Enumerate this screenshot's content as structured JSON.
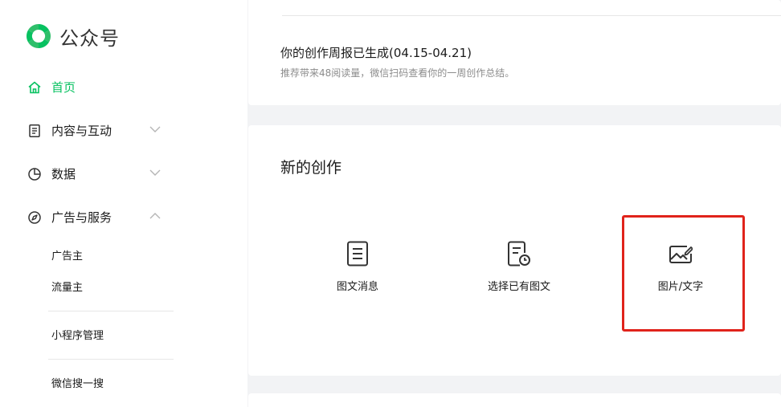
{
  "app": {
    "title": "公众号"
  },
  "sidebar": {
    "items": [
      {
        "label": "首页",
        "icon": "home-icon",
        "active": true
      },
      {
        "label": "内容与互动",
        "icon": "document-icon",
        "expanded": false
      },
      {
        "label": "数据",
        "icon": "pie-chart-icon",
        "expanded": false
      },
      {
        "label": "广告与服务",
        "icon": "compass-icon",
        "expanded": true
      }
    ],
    "sub_items": [
      {
        "label": "广告主"
      },
      {
        "label": "流量主"
      },
      {
        "label": "小程序管理"
      },
      {
        "label": "微信搜一搜"
      }
    ]
  },
  "report": {
    "title": "你的创作周报已生成(04.15-04.21)",
    "subtitle": "推荐带来48阅读量，微信扫码查看你的一周创作总结。"
  },
  "create": {
    "title": "新的创作",
    "options": [
      {
        "label": "图文消息",
        "icon": "article-icon"
      },
      {
        "label": "选择已有图文",
        "icon": "existing-article-icon"
      },
      {
        "label": "图片/文字",
        "icon": "image-text-icon",
        "highlighted": true
      }
    ]
  },
  "colors": {
    "brand_green": "#07c160",
    "highlight_red": "#e0231b",
    "background": "#f2f3f5",
    "muted_text": "#8c8c8c"
  }
}
